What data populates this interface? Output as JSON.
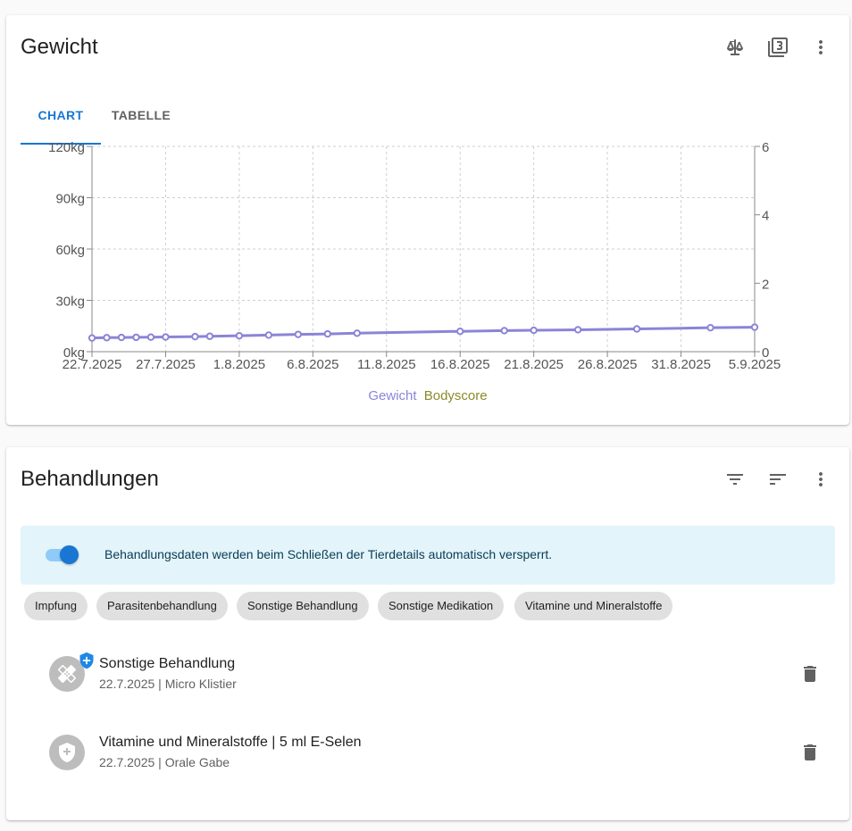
{
  "weight_card": {
    "title": "Gewicht",
    "icons": [
      "scale-icon",
      "copy-three-icon",
      "more-vert-icon"
    ],
    "tabs": [
      {
        "label": "CHART",
        "active": true
      },
      {
        "label": "TABELLE",
        "active": false
      }
    ]
  },
  "chart_data": {
    "type": "line",
    "x_tick_labels": [
      "22.7.2025",
      "27.7.2025",
      "1.8.2025",
      "6.8.2025",
      "11.8.2025",
      "16.8.2025",
      "21.8.2025",
      "26.8.2025",
      "31.8.2025",
      "5.9.2025"
    ],
    "y_left_tick_labels": [
      "0kg",
      "30kg",
      "60kg",
      "90kg",
      "120kg"
    ],
    "y_left_range": [
      0,
      120
    ],
    "y_right_tick_labels": [
      "0",
      "2",
      "4",
      "6"
    ],
    "y_right_range": [
      0,
      6
    ],
    "grid": true,
    "legend_position": "bottom",
    "series": [
      {
        "name": "Gewicht",
        "color": "#8b84d7",
        "x": [
          "2025-07-22",
          "2025-07-23",
          "2025-07-24",
          "2025-07-25",
          "2025-07-26",
          "2025-07-27",
          "2025-07-29",
          "2025-07-30",
          "2025-08-01",
          "2025-08-03",
          "2025-08-05",
          "2025-08-07",
          "2025-08-09",
          "2025-08-16",
          "2025-08-19",
          "2025-08-21",
          "2025-08-24",
          "2025-08-28",
          "2025-09-02",
          "2025-09-05"
        ],
        "y": [
          8.0,
          8.2,
          8.3,
          8.4,
          8.5,
          8.6,
          8.8,
          9.0,
          9.3,
          9.7,
          10.1,
          10.4,
          10.8,
          11.9,
          12.3,
          12.5,
          12.8,
          13.3,
          14.0,
          14.3
        ]
      },
      {
        "name": "Bodyscore",
        "color": "#8a8a2a",
        "x": [],
        "y": []
      }
    ]
  },
  "treatments_card": {
    "title": "Behandlungen",
    "icons": [
      "filter-icon",
      "sort-icon",
      "more-vert-icon"
    ],
    "info_text": "Behandlungsdaten werden beim Schließen der Tierdetails automatisch versperrt.",
    "toggle_on": true,
    "chips": [
      "Impfung",
      "Parasitenbehandlung",
      "Sonstige Behandlung",
      "Sonstige Medikation",
      "Vitamine und Mineralstoffe"
    ],
    "items": [
      {
        "title": "Sonstige Behandlung",
        "subtitle": "22.7.2025 | Micro Klistier",
        "icon": "bandage-icon",
        "badge": "shield-plus-badge-icon"
      },
      {
        "title": "Vitamine und Mineralstoffe | 5 ml E-Selen",
        "subtitle": "22.7.2025 | Orale Gabe",
        "icon": "shield-plus-icon",
        "badge": null
      }
    ]
  }
}
